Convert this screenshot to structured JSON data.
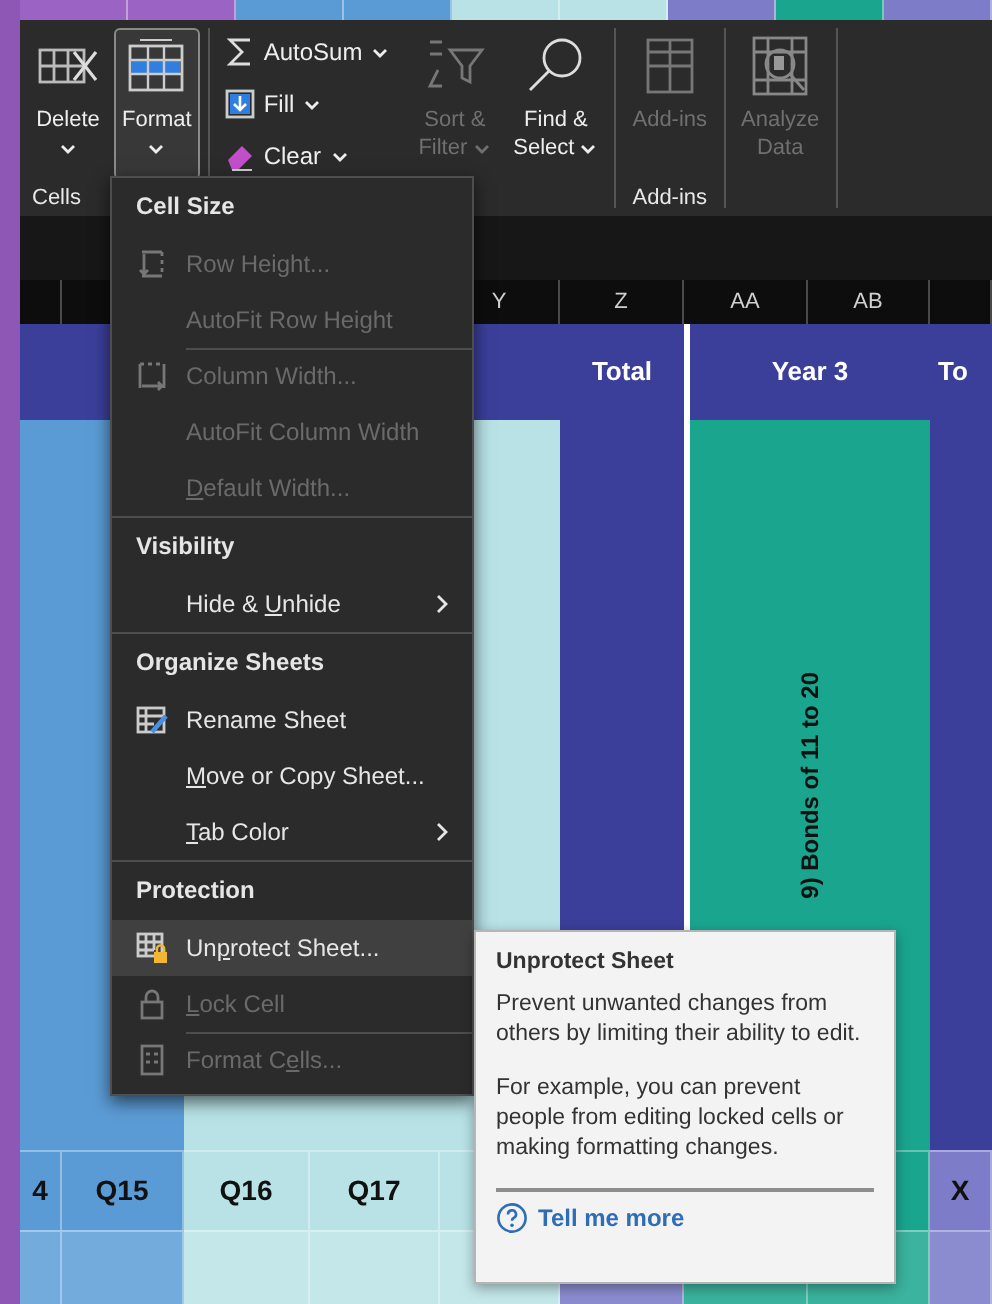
{
  "top_strip": [
    {
      "color": "#9a63c4"
    },
    {
      "color": "#9a63c4"
    },
    {
      "color": "#5b9bd5"
    },
    {
      "color": "#5b9bd5"
    },
    {
      "color": "#b8e2e6"
    },
    {
      "color": "#b8e2e6"
    },
    {
      "color": "#7c7cc8"
    },
    {
      "color": "#1aa58f"
    },
    {
      "color": "#7c7cc8"
    }
  ],
  "ribbon": {
    "groups": [
      {
        "label": "Cells",
        "controls": [
          {
            "kind": "large",
            "lines": [
              "Delete"
            ],
            "caret": true,
            "selected": false,
            "disabled": false
          },
          {
            "kind": "large",
            "lines": [
              "Format"
            ],
            "caret": true,
            "selected": true,
            "disabled": false
          }
        ]
      },
      {
        "controls": [
          {
            "kind": "stack",
            "items": [
              {
                "label": "AutoSum",
                "caret": true
              },
              {
                "label": "Fill",
                "caret": true
              },
              {
                "label": "Clear",
                "caret": true
              }
            ]
          },
          {
            "kind": "large",
            "lines": [
              "Sort &",
              "Filter"
            ],
            "caret": true,
            "selected": false,
            "disabled": true
          },
          {
            "kind": "large",
            "lines": [
              "Find &",
              "Select"
            ],
            "caret": true,
            "selected": false,
            "disabled": false
          }
        ]
      },
      {
        "label": "Add-ins",
        "controls": [
          {
            "kind": "large",
            "lines": [
              "Add-ins"
            ],
            "caret": false,
            "selected": false,
            "disabled": true
          }
        ]
      },
      {
        "controls": [
          {
            "kind": "large",
            "lines": [
              "Analyze",
              "Data"
            ],
            "caret": false,
            "selected": false,
            "disabled": true
          }
        ]
      }
    ]
  },
  "sheet": {
    "column_headers": [
      {
        "label": "Y"
      },
      {
        "label": "Z"
      },
      {
        "label": "AA"
      },
      {
        "label": "AB"
      }
    ],
    "rows": [
      {
        "kind": "title",
        "cells": [
          {
            "color": "#3b3f99"
          },
          {
            "color": "#3b3f99"
          },
          {},
          {},
          {
            "color": "#3b3f99"
          },
          {
            "color": "#3b3f99",
            "text": "Total"
          },
          {
            "color": "#3b3f99",
            "text": "Year 3",
            "wide": true
          },
          {
            "color": "#3b3f99",
            "text": "To"
          }
        ]
      },
      {
        "kind": "body",
        "cells": [
          {
            "color": "#5b9bd5"
          },
          {
            "color": "#5b9bd5"
          },
          {
            "color": "#b8e2e6"
          },
          {
            "color": "#b8e2e6"
          },
          {
            "color": "#b8e2e6"
          },
          {
            "color": "#3b3f99"
          },
          {
            "color": "#1aa58f",
            "text": "9) Bonds of 11 to 20",
            "wide": true,
            "vertical": true
          },
          {
            "color": "#3b3f99"
          }
        ]
      },
      {
        "kind": "data",
        "cells": [
          {
            "color": "#5b9bd5",
            "text": "4"
          },
          {
            "color": "#5b9bd5",
            "text": "Q15"
          },
          {
            "color": "#b8e2e6",
            "text": "Q16"
          },
          {
            "color": "#b8e2e6",
            "text": "Q17"
          },
          {
            "color": "#b8e2e6"
          },
          {},
          {},
          {
            "color": "#1aa58f"
          },
          {
            "color": "#7c7cc8",
            "text": "X"
          }
        ]
      },
      {
        "kind": "data",
        "cells": [
          {
            "color": "#74abdd"
          },
          {
            "color": "#74abdd"
          },
          {
            "color": "#c4e7ea"
          },
          {
            "color": "#c4e7ea"
          },
          {
            "color": "#c4e7ea"
          },
          {
            "color": "#8b8bd0"
          },
          {
            "color": "#3bb39e"
          },
          {
            "color": "#3bb39e"
          },
          {
            "color": "#8b8bd0"
          }
        ]
      }
    ]
  },
  "format_menu": {
    "sections": [
      {
        "header": "Cell Size",
        "items": [
          {
            "text": "Row Height...",
            "disabled": true,
            "selected": false,
            "submenu": false,
            "divider_before": false
          },
          {
            "text": "AutoFit Row Height",
            "disabled": true,
            "selected": false,
            "submenu": false,
            "divider_before": false
          },
          {
            "text": "Column Width...",
            "disabled": true,
            "selected": false,
            "submenu": false,
            "divider_before": true
          },
          {
            "text": "AutoFit Column Width",
            "disabled": true,
            "selected": false,
            "submenu": false,
            "divider_before": false
          },
          {
            "key": "D",
            "post": "efault Width...",
            "disabled": true,
            "selected": false,
            "submenu": false,
            "divider_before": false
          }
        ]
      },
      {
        "header": "Visibility",
        "items": [
          {
            "pre": "Hide & ",
            "key": "U",
            "post": "nhide",
            "disabled": false,
            "selected": false,
            "submenu": true,
            "divider_before": false
          }
        ]
      },
      {
        "header": "Organize Sheets",
        "items": [
          {
            "text": "Rename Sheet",
            "disabled": false,
            "selected": false,
            "submenu": false,
            "divider_before": false
          },
          {
            "key": "M",
            "post": "ove or Copy Sheet...",
            "disabled": false,
            "selected": false,
            "submenu": false,
            "divider_before": false
          },
          {
            "key": "T",
            "post": "ab Color",
            "disabled": false,
            "selected": false,
            "submenu": true,
            "divider_before": false
          }
        ]
      },
      {
        "header": "Protection",
        "items": [
          {
            "pre": "Un",
            "key": "p",
            "post": "rotect Sheet...",
            "disabled": false,
            "selected": true,
            "submenu": false,
            "divider_before": false
          },
          {
            "key": "L",
            "post": "ock Cell",
            "disabled": true,
            "selected": false,
            "submenu": false,
            "divider_before": false
          },
          {
            "pre": "Format C",
            "key": "e",
            "post": "lls...",
            "disabled": true,
            "selected": false,
            "submenu": false,
            "divider_before": true
          }
        ]
      }
    ]
  },
  "tooltip": {
    "title": "Unprotect Sheet",
    "paragraphs": [
      "Prevent unwanted changes from others by limiting their ability to edit.",
      "For example, you can prevent people from editing locked cells or making formatting changes."
    ],
    "link": "Tell me more"
  }
}
